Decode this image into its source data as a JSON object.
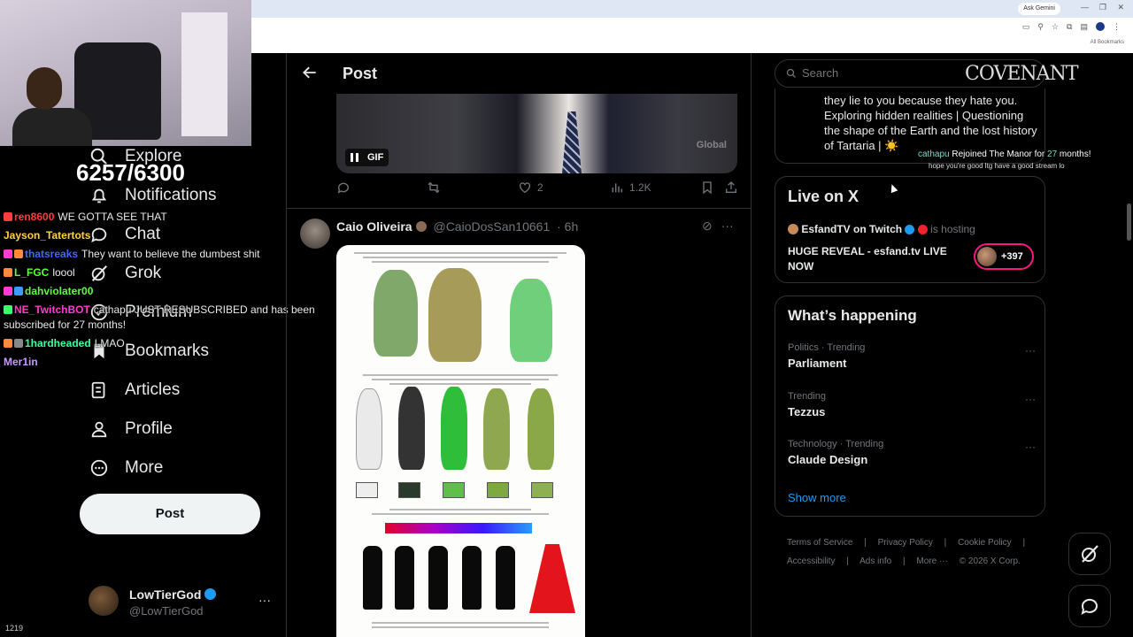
{
  "stream": {
    "goal_counter": "6257/6300",
    "bottom_count": "1219",
    "brand_overlay": "COVENANT",
    "sub_alert": {
      "user": "cathapu",
      "pre": " Rejoined The Manor for ",
      "months": "27",
      "post": " months!"
    },
    "sub_alert_msg": "hope you're good ltg have a good stream lo",
    "chat": [
      {
        "user": "ren8600",
        "color": "#ff3b3b",
        "text": "WE GOTTA SEE THAT"
      },
      {
        "user": "Jayson_Tatertots",
        "color": "#ffd23f",
        "text": ""
      },
      {
        "user": "thatsreaks",
        "color": "#3b6bff",
        "text": "They want to believe the dumbest shit"
      },
      {
        "user": "L_FGC",
        "color": "#ffa53b",
        "text": "loool"
      },
      {
        "user": "dahviolater00",
        "color": "#5cff3b",
        "text": ""
      },
      {
        "user": "NE_TwitchBOT",
        "color": "#ff3bd0",
        "text": "cathapu JUST RESUBSCRIBED and has been"
      },
      {
        "user": "",
        "color": "#ffffff",
        "text": "subscribed for 27 months!"
      },
      {
        "user": "1hardheaded",
        "color": "#3bff9e",
        "text": "LMAO"
      },
      {
        "user": "Mer1in",
        "color": "#c79bff",
        "text": ""
      }
    ]
  },
  "browser": {
    "gemini_label": "Ask Gemini",
    "bookmarks_label": "All Bookmarks"
  },
  "nav": {
    "items": [
      {
        "label": "Explore",
        "icon": "search-icon"
      },
      {
        "label": "Notifications",
        "icon": "bell-icon"
      },
      {
        "label": "Chat",
        "icon": "chat-icon"
      },
      {
        "label": "Grok",
        "icon": "grok-icon"
      },
      {
        "label": "Premium",
        "icon": "premium-icon"
      },
      {
        "label": "Bookmarks",
        "icon": "bookmark-icon"
      },
      {
        "label": "Articles",
        "icon": "article-icon"
      },
      {
        "label": "Profile",
        "icon": "profile-icon"
      },
      {
        "label": "More",
        "icon": "more-icon"
      }
    ],
    "post_button": "Post",
    "account": {
      "name": "LowTierGod",
      "handle": "@LowTierGod"
    }
  },
  "main": {
    "header_title": "Post",
    "gif_label": "GIF",
    "gif_watermark": "Global",
    "actions": {
      "replies": "",
      "reposts": "",
      "likes": "2",
      "views": "1.2K"
    },
    "tweet2": {
      "name": "Caio Oliveira",
      "handle": "@CaioDosSan10661",
      "time": "· 6h"
    }
  },
  "right": {
    "search_placeholder": "Search",
    "bio_text": "they lie to you because they hate you. Exploring hidden realities | Questioning the shape of the Earth and the lost history of Tartaria | ☀️",
    "live": {
      "title": "Live on X",
      "host_name": "EsfandTV on Twitch",
      "host_suffix": "is hosting",
      "stream_title": "HUGE REVEAL - esfand.tv LIVE NOW",
      "viewer_count": "+397"
    },
    "happening": {
      "title": "What’s happening",
      "trends": [
        {
          "context": "Politics · Trending",
          "name": "Parliament"
        },
        {
          "context": "Trending",
          "name": "Tezzus"
        },
        {
          "context": "Technology · Trending",
          "name": "Claude Design"
        }
      ],
      "show_more": "Show more"
    },
    "footer": {
      "line1": [
        "Terms of Service",
        "|",
        "Privacy Policy",
        "|",
        "Cookie Policy",
        "|"
      ],
      "line2": [
        "Accessibility",
        "|",
        "Ads info",
        "|",
        "More ···",
        "© 2026 X Corp."
      ]
    }
  }
}
